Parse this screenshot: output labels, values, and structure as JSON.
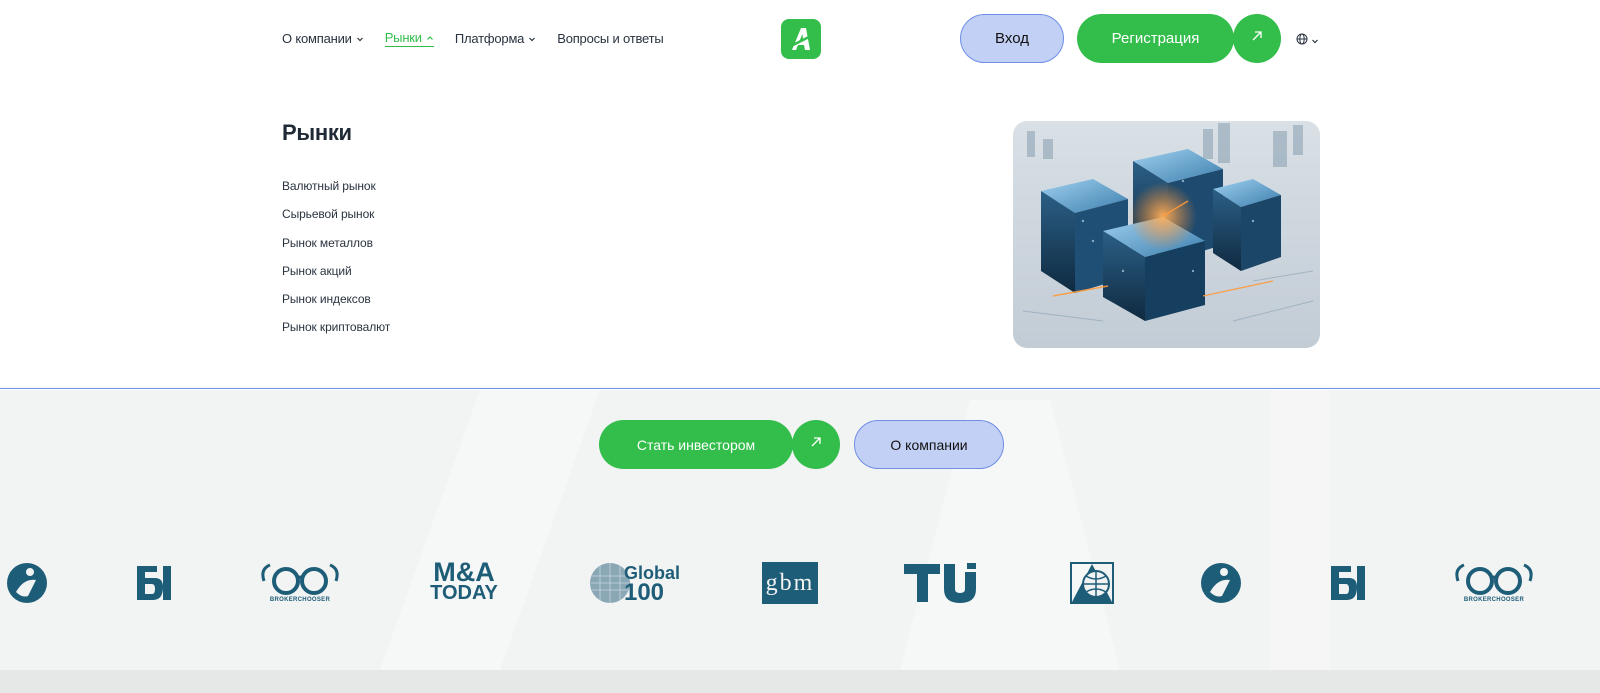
{
  "header": {
    "nav": [
      {
        "label": "О компании",
        "has_dropdown": true,
        "active": false
      },
      {
        "label": "Рынки",
        "has_dropdown": true,
        "active": true
      },
      {
        "label": "Платформа",
        "has_dropdown": true,
        "active": false
      },
      {
        "label": "Вопросы и ответы",
        "has_dropdown": false,
        "active": false
      }
    ],
    "logo_icon": "brand-logo-a-icon",
    "login_label": "Вход",
    "register_label": "Регистрация",
    "language_icon": "globe-icon"
  },
  "panel": {
    "title": "Рынки",
    "items": [
      {
        "label": "Валютный рынок"
      },
      {
        "label": "Сырьевой рынок"
      },
      {
        "label": "Рынок металлов"
      },
      {
        "label": "Рынок акций"
      },
      {
        "label": "Рынок индексов"
      },
      {
        "label": "Рынок криптовалют"
      }
    ],
    "image": "glowing-data-cubes-illustration"
  },
  "cta": {
    "invest_label": "Стать инвестором",
    "about_label": "О компании"
  },
  "partners": {
    "logos": [
      {
        "name": "i-circle-logo"
      },
      {
        "name": "bt-logo"
      },
      {
        "name": "brokerchooser-logo",
        "text": "BROKERCHOOSER"
      },
      {
        "name": "ma-today-logo",
        "line1": "M&A",
        "line2": "TODAY"
      },
      {
        "name": "global-100-logo",
        "line1": "Global",
        "line2": "100"
      },
      {
        "name": "gbm-logo",
        "text": "gbm"
      },
      {
        "name": "tu-logo",
        "text": "TU"
      },
      {
        "name": "globe-square-logo"
      },
      {
        "name": "i-circle-logo"
      },
      {
        "name": "bt-logo"
      },
      {
        "name": "brokerchooser-logo",
        "text": "BROKERCHOOSER"
      }
    ]
  },
  "colors": {
    "brand_green": "#33bd4b",
    "login_blue": "#c3d0f5",
    "border_blue": "#6f8fe6",
    "logo_teal": "#1e5d78",
    "section_grey": "#f2f3f3"
  }
}
